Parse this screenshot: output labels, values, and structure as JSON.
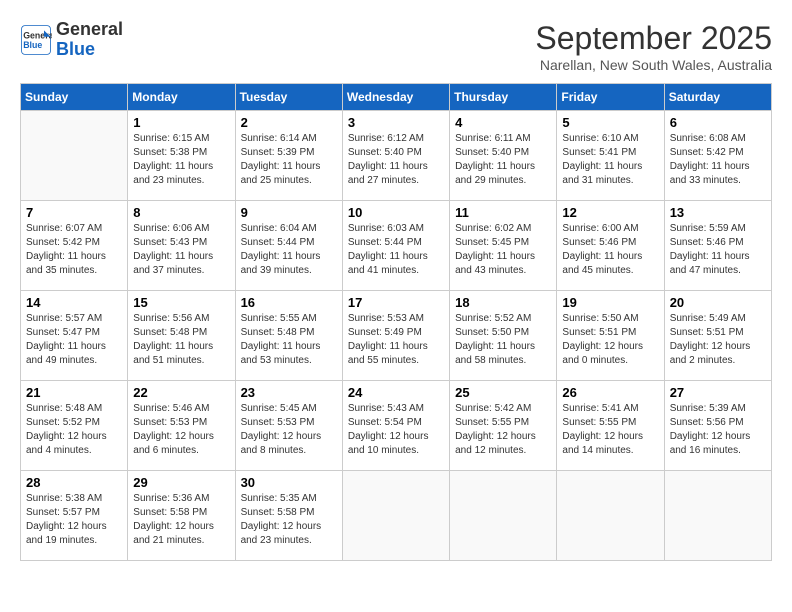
{
  "logo": {
    "line1": "General",
    "line2": "Blue"
  },
  "title": "September 2025",
  "location": "Narellan, New South Wales, Australia",
  "days_of_week": [
    "Sunday",
    "Monday",
    "Tuesday",
    "Wednesday",
    "Thursday",
    "Friday",
    "Saturday"
  ],
  "weeks": [
    [
      {
        "day": "",
        "info": ""
      },
      {
        "day": "1",
        "info": "Sunrise: 6:15 AM\nSunset: 5:38 PM\nDaylight: 11 hours\nand 23 minutes."
      },
      {
        "day": "2",
        "info": "Sunrise: 6:14 AM\nSunset: 5:39 PM\nDaylight: 11 hours\nand 25 minutes."
      },
      {
        "day": "3",
        "info": "Sunrise: 6:12 AM\nSunset: 5:40 PM\nDaylight: 11 hours\nand 27 minutes."
      },
      {
        "day": "4",
        "info": "Sunrise: 6:11 AM\nSunset: 5:40 PM\nDaylight: 11 hours\nand 29 minutes."
      },
      {
        "day": "5",
        "info": "Sunrise: 6:10 AM\nSunset: 5:41 PM\nDaylight: 11 hours\nand 31 minutes."
      },
      {
        "day": "6",
        "info": "Sunrise: 6:08 AM\nSunset: 5:42 PM\nDaylight: 11 hours\nand 33 minutes."
      }
    ],
    [
      {
        "day": "7",
        "info": "Sunrise: 6:07 AM\nSunset: 5:42 PM\nDaylight: 11 hours\nand 35 minutes."
      },
      {
        "day": "8",
        "info": "Sunrise: 6:06 AM\nSunset: 5:43 PM\nDaylight: 11 hours\nand 37 minutes."
      },
      {
        "day": "9",
        "info": "Sunrise: 6:04 AM\nSunset: 5:44 PM\nDaylight: 11 hours\nand 39 minutes."
      },
      {
        "day": "10",
        "info": "Sunrise: 6:03 AM\nSunset: 5:44 PM\nDaylight: 11 hours\nand 41 minutes."
      },
      {
        "day": "11",
        "info": "Sunrise: 6:02 AM\nSunset: 5:45 PM\nDaylight: 11 hours\nand 43 minutes."
      },
      {
        "day": "12",
        "info": "Sunrise: 6:00 AM\nSunset: 5:46 PM\nDaylight: 11 hours\nand 45 minutes."
      },
      {
        "day": "13",
        "info": "Sunrise: 5:59 AM\nSunset: 5:46 PM\nDaylight: 11 hours\nand 47 minutes."
      }
    ],
    [
      {
        "day": "14",
        "info": "Sunrise: 5:57 AM\nSunset: 5:47 PM\nDaylight: 11 hours\nand 49 minutes."
      },
      {
        "day": "15",
        "info": "Sunrise: 5:56 AM\nSunset: 5:48 PM\nDaylight: 11 hours\nand 51 minutes."
      },
      {
        "day": "16",
        "info": "Sunrise: 5:55 AM\nSunset: 5:48 PM\nDaylight: 11 hours\nand 53 minutes."
      },
      {
        "day": "17",
        "info": "Sunrise: 5:53 AM\nSunset: 5:49 PM\nDaylight: 11 hours\nand 55 minutes."
      },
      {
        "day": "18",
        "info": "Sunrise: 5:52 AM\nSunset: 5:50 PM\nDaylight: 11 hours\nand 58 minutes."
      },
      {
        "day": "19",
        "info": "Sunrise: 5:50 AM\nSunset: 5:51 PM\nDaylight: 12 hours\nand 0 minutes."
      },
      {
        "day": "20",
        "info": "Sunrise: 5:49 AM\nSunset: 5:51 PM\nDaylight: 12 hours\nand 2 minutes."
      }
    ],
    [
      {
        "day": "21",
        "info": "Sunrise: 5:48 AM\nSunset: 5:52 PM\nDaylight: 12 hours\nand 4 minutes."
      },
      {
        "day": "22",
        "info": "Sunrise: 5:46 AM\nSunset: 5:53 PM\nDaylight: 12 hours\nand 6 minutes."
      },
      {
        "day": "23",
        "info": "Sunrise: 5:45 AM\nSunset: 5:53 PM\nDaylight: 12 hours\nand 8 minutes."
      },
      {
        "day": "24",
        "info": "Sunrise: 5:43 AM\nSunset: 5:54 PM\nDaylight: 12 hours\nand 10 minutes."
      },
      {
        "day": "25",
        "info": "Sunrise: 5:42 AM\nSunset: 5:55 PM\nDaylight: 12 hours\nand 12 minutes."
      },
      {
        "day": "26",
        "info": "Sunrise: 5:41 AM\nSunset: 5:55 PM\nDaylight: 12 hours\nand 14 minutes."
      },
      {
        "day": "27",
        "info": "Sunrise: 5:39 AM\nSunset: 5:56 PM\nDaylight: 12 hours\nand 16 minutes."
      }
    ],
    [
      {
        "day": "28",
        "info": "Sunrise: 5:38 AM\nSunset: 5:57 PM\nDaylight: 12 hours\nand 19 minutes."
      },
      {
        "day": "29",
        "info": "Sunrise: 5:36 AM\nSunset: 5:58 PM\nDaylight: 12 hours\nand 21 minutes."
      },
      {
        "day": "30",
        "info": "Sunrise: 5:35 AM\nSunset: 5:58 PM\nDaylight: 12 hours\nand 23 minutes."
      },
      {
        "day": "",
        "info": ""
      },
      {
        "day": "",
        "info": ""
      },
      {
        "day": "",
        "info": ""
      },
      {
        "day": "",
        "info": ""
      }
    ]
  ]
}
